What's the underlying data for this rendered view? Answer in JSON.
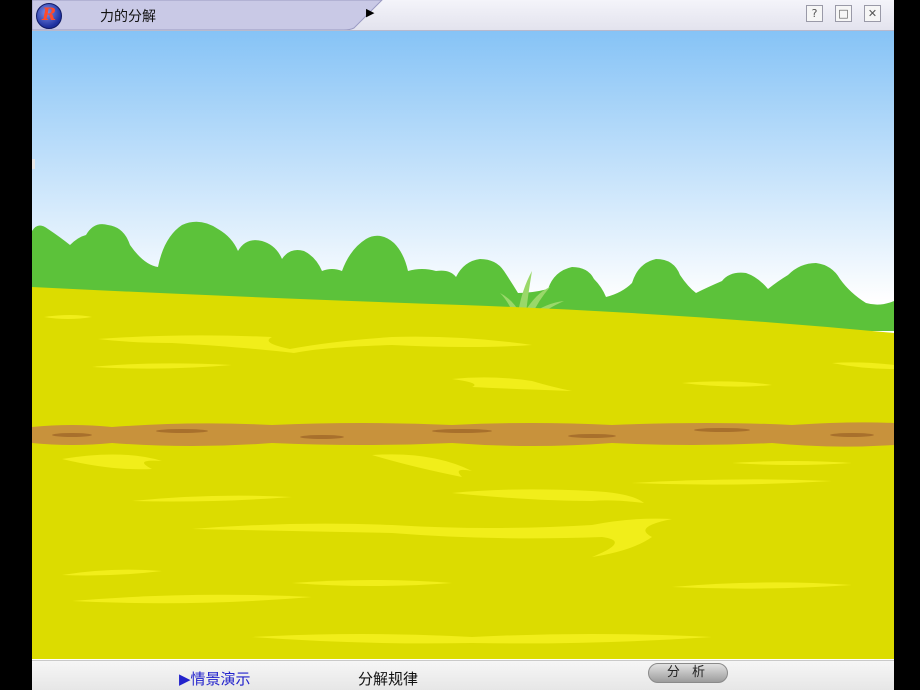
{
  "window": {
    "title": "力的分解",
    "logo_letter": "R",
    "play_symbol": "▶",
    "help_symbol": "?",
    "restore_symbol": "□",
    "close_symbol": "✕"
  },
  "footer": {
    "nav_scene": "▶情景演示",
    "nav_rule": "分解规律",
    "analyze_label": "分 析"
  },
  "colors": {
    "sky_top": "#86c3f6",
    "sky_bottom": "#ffffff",
    "bushes": "#5cc23a",
    "field": "#dcdc00",
    "path": "#c8923c"
  }
}
